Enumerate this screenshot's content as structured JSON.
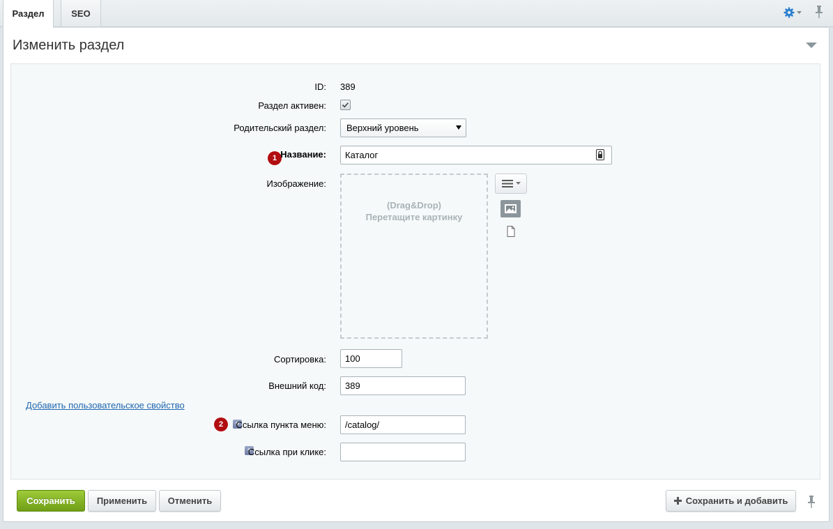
{
  "tabs": [
    {
      "label": "Раздел",
      "active": true
    },
    {
      "label": "SEO",
      "active": false
    }
  ],
  "header": {
    "title": "Изменить раздел"
  },
  "form": {
    "id_label": "ID:",
    "id_value": "389",
    "active_label": "Раздел активен:",
    "active_checked": true,
    "parent_label": "Родительский раздел:",
    "parent_value": "Верхний уровень",
    "name_label": "Название:",
    "name_value": "Каталог",
    "name_badge": "1",
    "image_label": "Изображение:",
    "dropzone_line1": "(Drag&Drop)",
    "dropzone_line2": "Перетащите картинку",
    "sort_label": "Сортировка:",
    "sort_value": "100",
    "external_label": "Внешний код:",
    "external_value": "389",
    "add_property_link": "Добавить пользовательское свойство",
    "menu_link_label": "Ссылка пункта меню:",
    "menu_link_value": "/catalog/",
    "menu_link_badge": "2",
    "click_link_label": "Ссылка при клике:",
    "click_link_value": "",
    "help_glyph": "?"
  },
  "buttons": {
    "save": "Сохранить",
    "apply": "Применить",
    "cancel": "Отменить",
    "save_and_add": "Сохранить и добавить"
  },
  "colors": {
    "accent_green": "#7aa81f",
    "badge_red": "#b10e11",
    "link_blue": "#2067b0",
    "gear_blue": "#2a7fd0"
  },
  "icons": {
    "settings": "gear-icon",
    "pin": "pin-icon",
    "collapse": "triangle-down-icon",
    "lock": "lock-icon",
    "menu": "hamburger-icon",
    "image": "image-icon",
    "file": "file-icon",
    "plus": "plus-icon",
    "help": "help-icon"
  }
}
